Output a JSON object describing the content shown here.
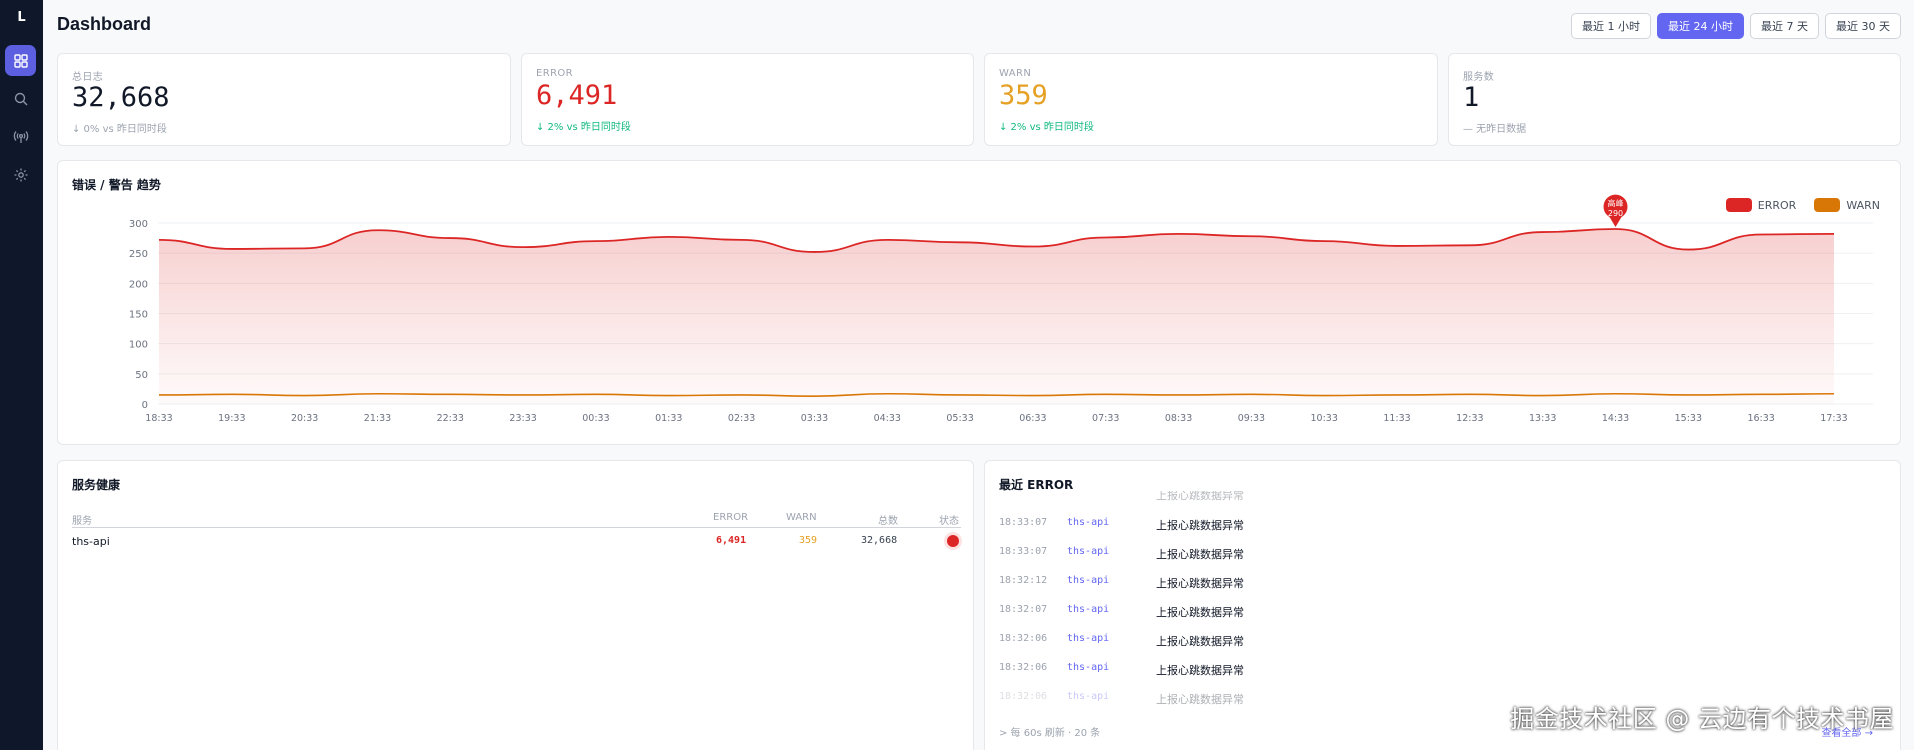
{
  "sidebar": {
    "logo": "L",
    "items": [
      {
        "icon": "dashboard-icon",
        "active": true
      },
      {
        "icon": "search-icon",
        "active": false
      },
      {
        "icon": "broadcast-icon",
        "active": false
      },
      {
        "icon": "gear-icon",
        "active": false
      }
    ]
  },
  "header": {
    "title": "Dashboard",
    "ranges": [
      "最近 1 小时",
      "最近 24 小时",
      "最近 7 天",
      "最近 30 天"
    ],
    "active_range": 1
  },
  "stats": [
    {
      "label": "总日志",
      "value": "32,668",
      "delta": "↓ 0% vs 昨日同时段",
      "color": "#111827",
      "delta_color": "gray"
    },
    {
      "label": "ERROR",
      "value": "6,491",
      "delta": "↓ 2% vs 昨日同时段",
      "color": "#dc2626",
      "delta_color": "green"
    },
    {
      "label": "WARN",
      "value": "359",
      "delta": "↓ 2% vs 昨日同时段",
      "color": "#e6a023",
      "delta_color": "green"
    },
    {
      "label": "服务数",
      "value": "1",
      "delta": "— 无昨日数据",
      "color": "#111827",
      "delta_color": "gray"
    }
  ],
  "chart_panel": {
    "title": "错误 / 警告 趋势",
    "peak_label": "高峰",
    "peak_value": "290"
  },
  "chart_data": {
    "type": "area",
    "title": "错误 / 警告 趋势",
    "categories": [
      "18:33",
      "19:33",
      "20:33",
      "21:33",
      "22:33",
      "23:33",
      "00:33",
      "01:33",
      "02:33",
      "03:33",
      "04:33",
      "05:33",
      "06:33",
      "07:33",
      "08:33",
      "09:33",
      "10:33",
      "11:33",
      "12:33",
      "13:33",
      "14:33",
      "15:33",
      "16:33",
      "17:33"
    ],
    "series": [
      {
        "name": "ERROR",
        "color": "#dc2626",
        "values": [
          272,
          257,
          258,
          288,
          275,
          260,
          270,
          277,
          272,
          252,
          272,
          268,
          261,
          276,
          282,
          278,
          270,
          262,
          263,
          285,
          290,
          256,
          281,
          282
        ]
      },
      {
        "name": "WARN",
        "color": "#d97706",
        "values": [
          15,
          16,
          14,
          17,
          16,
          15,
          16,
          14,
          15,
          13,
          17,
          15,
          14,
          16,
          15,
          16,
          14,
          15,
          16,
          14,
          17,
          15,
          16,
          17
        ]
      }
    ],
    "y_ticks": [
      0,
      50,
      100,
      150,
      200,
      250,
      300
    ],
    "ylim": [
      0,
      300
    ],
    "grid": true,
    "legend": "top-right"
  },
  "services_panel": {
    "title": "服务健康",
    "columns": [
      "服务",
      "ERROR",
      "WARN",
      "总数",
      "状态"
    ],
    "rows": [
      {
        "service": "ths-api",
        "error": "6,491",
        "warn": "359",
        "total": "32,668",
        "status": "error"
      }
    ]
  },
  "errors_panel": {
    "title": "最近 ERROR",
    "partial_top": "上报心跳数据异常",
    "rows": [
      {
        "time": "18:33:07",
        "service": "ths-api",
        "message": "上报心跳数据异常"
      },
      {
        "time": "18:33:07",
        "service": "ths-api",
        "message": "上报心跳数据异常"
      },
      {
        "time": "18:32:12",
        "service": "ths-api",
        "message": "上报心跳数据异常"
      },
      {
        "time": "18:32:07",
        "service": "ths-api",
        "message": "上报心跳数据异常"
      },
      {
        "time": "18:32:06",
        "service": "ths-api",
        "message": "上报心跳数据异常"
      },
      {
        "time": "18:32:06",
        "service": "ths-api",
        "message": "上报心跳数据异常"
      },
      {
        "time": "18:32:06",
        "service": "ths-api",
        "message": "上报心跳数据异常"
      }
    ],
    "footer": "> 每 60s 刷新 · 20 条",
    "view_all": "查看全部 →"
  },
  "watermark": "掘金技术社区 @ 云边有个技术书屋"
}
